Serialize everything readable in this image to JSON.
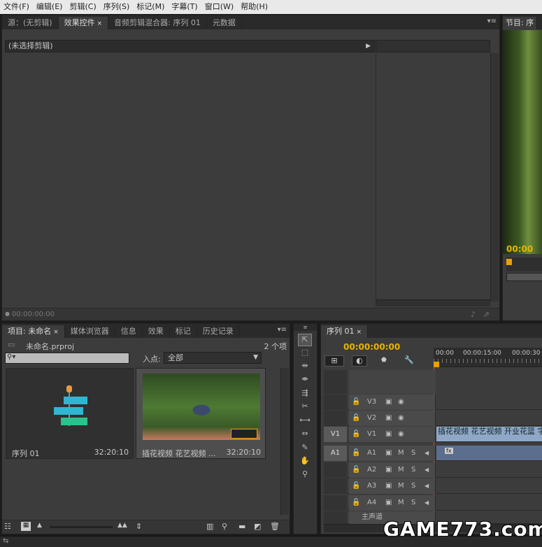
{
  "menu": [
    "文件(F)",
    "编辑(E)",
    "剪辑(C)",
    "序列(S)",
    "标记(M)",
    "字幕(T)",
    "窗口(W)",
    "帮助(H)"
  ],
  "source_panel": {
    "tabs": [
      "源：(无剪辑)",
      "效果控件",
      "音频剪辑混合器: 序列 01",
      "元数据"
    ],
    "header": "(未选择剪辑)",
    "timecode": "00:00:00:00"
  },
  "program_panel": {
    "tab": "节目: 序",
    "timecode": "00:00"
  },
  "project_panel": {
    "tabs": [
      "项目: 未命名",
      "媒体浏览器",
      "信息",
      "效果",
      "标记",
      "历史记录"
    ],
    "file": "未命名.prproj",
    "count": "2 个项",
    "inpoint_label": "入点:",
    "inpoint_value": "全部",
    "items": [
      {
        "name": "序列 01",
        "duration": "32:20:10"
      },
      {
        "name": "插花视频 花艺视频 ...",
        "duration": "32:20:10"
      }
    ]
  },
  "timeline": {
    "tab": "序列 01",
    "timecode": "00:00:00:00",
    "ruler": [
      "00:00",
      "00:00:15:00",
      "00:00:30"
    ],
    "tracks": [
      {
        "src": "",
        "name": "V3"
      },
      {
        "src": "",
        "name": "V2"
      },
      {
        "src": "V1",
        "name": "V1"
      },
      {
        "src": "A1",
        "name": "A1"
      },
      {
        "src": "",
        "name": "A2"
      },
      {
        "src": "",
        "name": "A3"
      },
      {
        "src": "",
        "name": "A4"
      },
      {
        "src": "",
        "name": "主声道"
      }
    ],
    "m": "M",
    "s": "S",
    "video_clip": "插花视频 花艺视频 开业花篮 字",
    "fx": "fx"
  },
  "watermark": "GAME773.com"
}
